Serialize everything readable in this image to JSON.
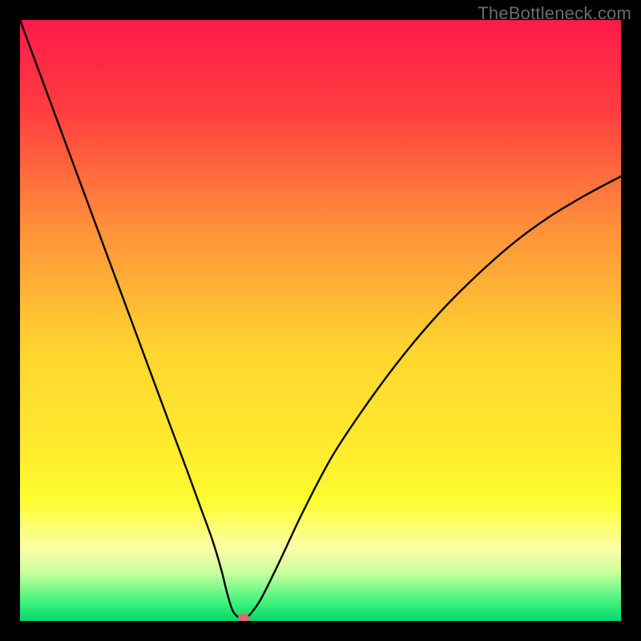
{
  "watermark": "TheBottleneck.com",
  "chart_data": {
    "type": "line",
    "title": "",
    "xlabel": "",
    "ylabel": "",
    "xlim": [
      0,
      100
    ],
    "ylim": [
      0,
      100
    ],
    "grid": false,
    "legend": false,
    "background": {
      "type": "vertical-gradient",
      "stops": [
        {
          "pos": 0.0,
          "color": "#ff1a49"
        },
        {
          "pos": 0.15,
          "color": "#ff3d40"
        },
        {
          "pos": 0.35,
          "color": "#ff923a"
        },
        {
          "pos": 0.55,
          "color": "#ffd530"
        },
        {
          "pos": 0.7,
          "color": "#ffe92e"
        },
        {
          "pos": 0.8,
          "color": "#fffc30"
        },
        {
          "pos": 0.88,
          "color": "#fbffa8"
        },
        {
          "pos": 0.92,
          "color": "#c8ff9e"
        },
        {
          "pos": 0.97,
          "color": "#3cf27a"
        },
        {
          "pos": 1.0,
          "color": "#06d66c"
        }
      ]
    },
    "series": [
      {
        "name": "bottleneck-curve",
        "color": "#000000",
        "width": 2.4,
        "x": [
          0,
          5,
          10,
          15,
          20,
          25,
          28,
          30,
          32,
          33.5,
          34.5,
          35.5,
          37,
          38,
          40,
          43,
          47,
          52,
          58,
          64,
          70,
          76,
          82,
          88,
          94,
          100
        ],
        "y": [
          100,
          86.5,
          73,
          59.5,
          46,
          32.5,
          24.5,
          19,
          13.5,
          8.5,
          4.5,
          1.5,
          0.3,
          0.8,
          3.5,
          9.5,
          18,
          27.5,
          36.5,
          44.5,
          51.5,
          57.5,
          62.8,
          67.2,
          70.8,
          74
        ]
      }
    ],
    "markers": [
      {
        "name": "marker-dot",
        "x": 37.2,
        "y": 0.6,
        "color": "#d46d6a"
      }
    ]
  }
}
